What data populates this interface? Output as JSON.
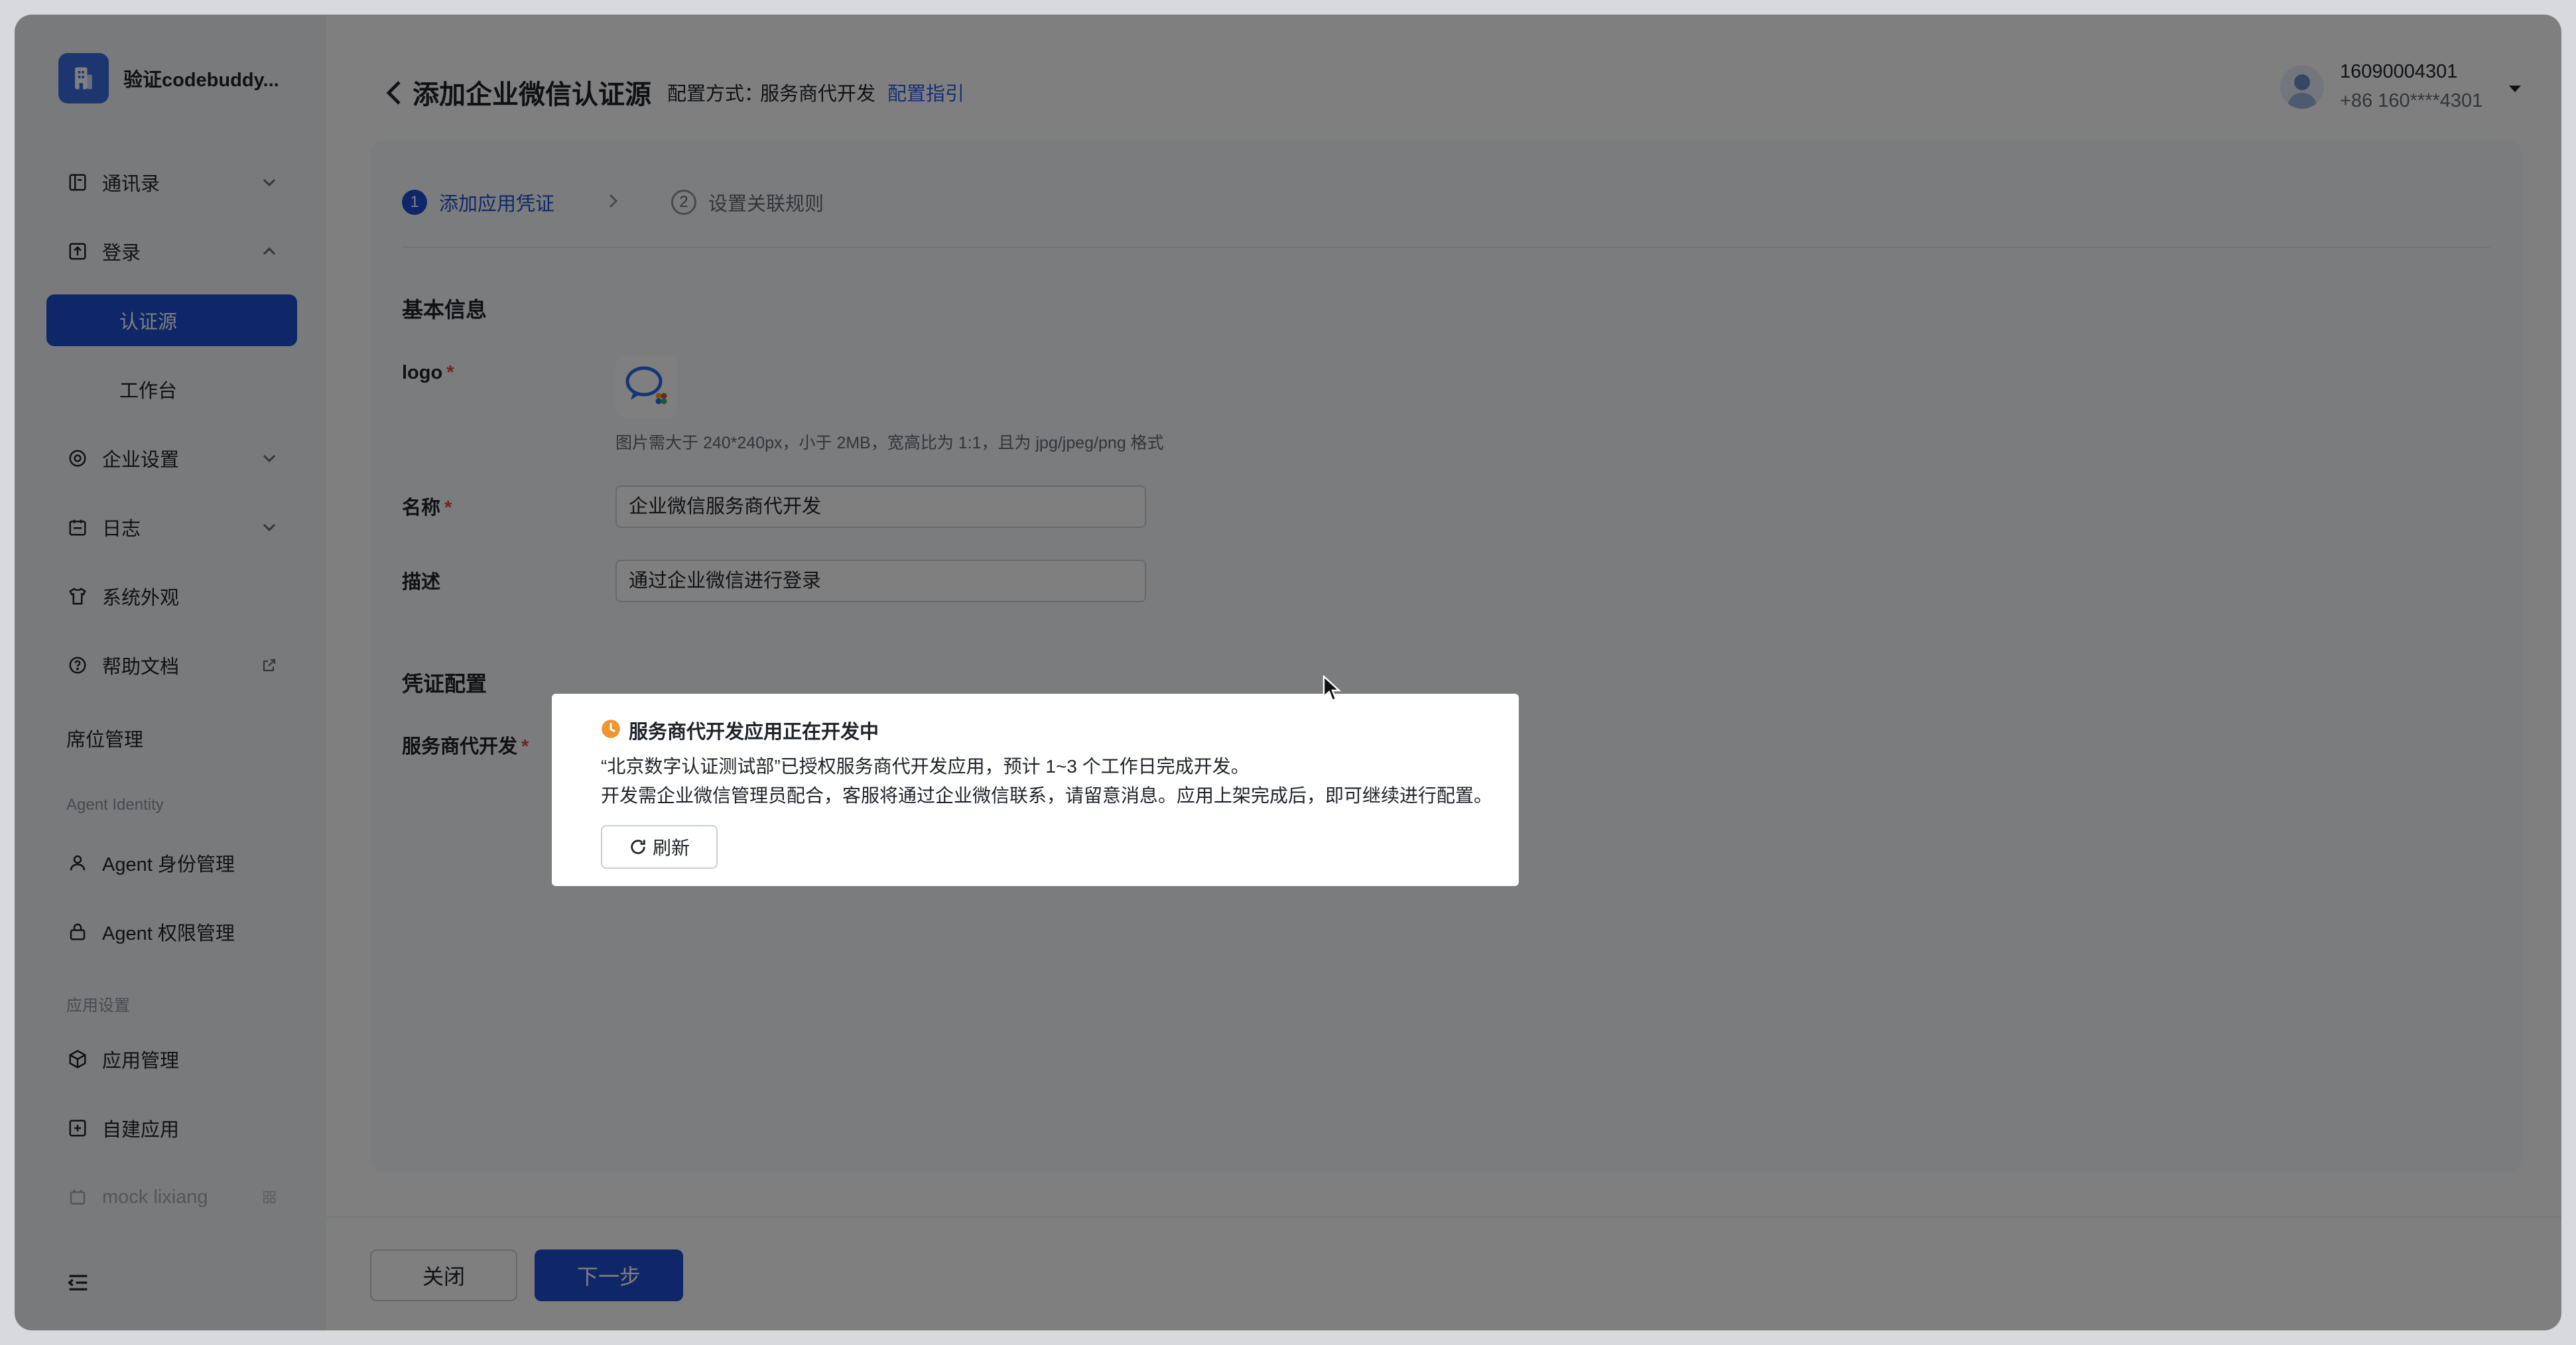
{
  "workspace": {
    "name": "验证codebuddy..."
  },
  "sidebar": {
    "contacts": "通讯录",
    "login": "登录",
    "auth_source": "认证源",
    "workbench": "工作台",
    "org_settings": "企业设置",
    "logs": "日志",
    "appearance": "系统外观",
    "help_docs": "帮助文档",
    "seat_management": "席位管理",
    "agent_section": "Agent Identity",
    "agent_identity_mgmt": "Agent 身份管理",
    "agent_permission_mgmt": "Agent 权限管理",
    "app_section": "应用设置",
    "app_management": "应用管理",
    "custom_apps": "自建应用",
    "clipped_item": "mock lixiang"
  },
  "header": {
    "title": "添加企业微信认证源",
    "config_method_label": "配置方式：",
    "config_method_value": "服务商代开发",
    "config_guide_link": "配置指引"
  },
  "user": {
    "name": "16090004301",
    "phone": "+86 160****4301"
  },
  "steps": [
    {
      "number": "1",
      "label": "添加应用凭证",
      "state": "active"
    },
    {
      "number": "2",
      "label": "设置关联规则",
      "state": "idle"
    }
  ],
  "form": {
    "basic_info_title": "基本信息",
    "logo_label": "logo",
    "logo_hint": "图片需大于 240*240px，小于 2MB，宽高比为 1:1，且为 jpg/jpeg/png 格式",
    "name_label": "名称",
    "name_value": "企业微信服务商代开发",
    "desc_label": "描述",
    "desc_value": "通过企业微信进行登录",
    "credential_title": "凭证配置",
    "provider_label": "服务商代开发",
    "required_mark": "*"
  },
  "footer": {
    "close_label": "关闭",
    "next_label": "下一步"
  },
  "modal": {
    "title": "服务商代开发应用正在开发中",
    "line1": "“北京数字认证测试部”已授权服务商代开发应用，预计 1~3 个工作日完成开发。",
    "line2": "开发需企业微信管理员配合，客服将通过企业微信联系，请留意消息。应用上架完成后，即可继续进行配置。",
    "refresh_label": "刷新"
  },
  "colors": {
    "primary": "#1e4fd1",
    "link": "#2b5fe0",
    "required": "#e34d3d",
    "pending": "#f0962c",
    "sidebar_bg": "#f3f4f7"
  }
}
